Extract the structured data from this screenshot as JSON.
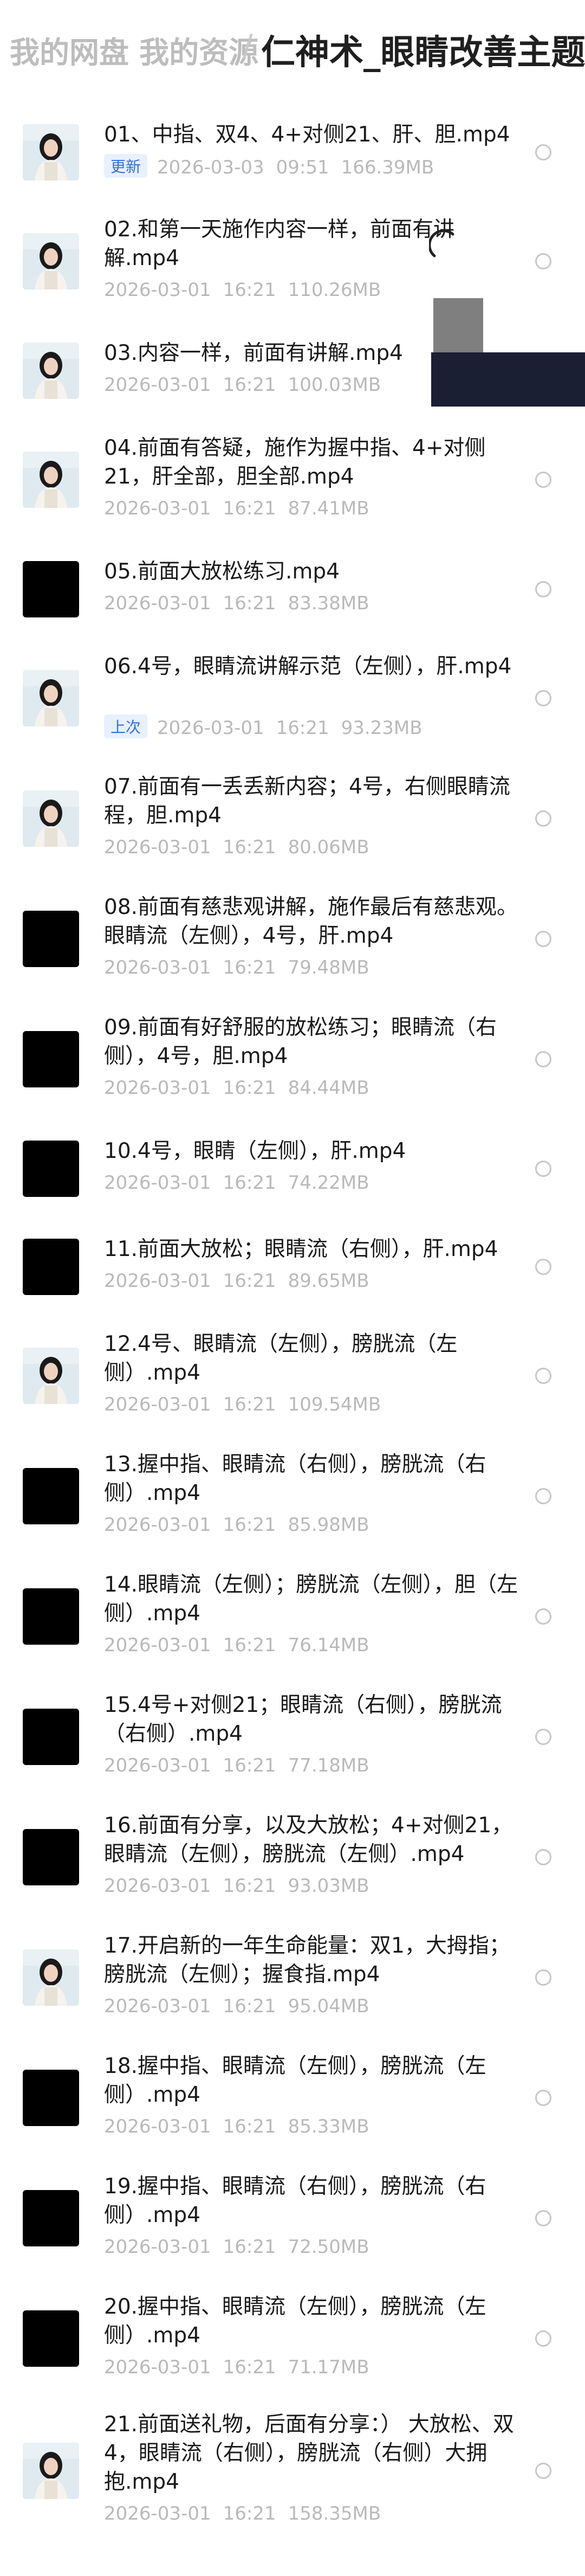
{
  "breadcrumb": {
    "root": "我的网盘 我的资源",
    "separator": "/",
    "current": "仁神术_眼睛改善主题共修"
  },
  "files": [
    {
      "name": "01、中指、双4、4+对侧21、肝、胆.mp4",
      "badge": "更新",
      "date": "2026-03-03",
      "time": "09:51",
      "size": "166.39MB",
      "thumb": "person"
    },
    {
      "name": "02.和第一天施作内容一样，前面有讲解.mp4",
      "badge": "",
      "date": "2026-03-01",
      "time": "16:21",
      "size": "110.26MB",
      "thumb": "person"
    },
    {
      "name": "03.内容一样，前面有讲解.mp4",
      "badge": "",
      "date": "2026-03-01",
      "time": "16:21",
      "size": "100.03MB",
      "thumb": "person"
    },
    {
      "name": "04.前面有答疑，施作为握中指、4+对侧21，肝全部，胆全部.mp4",
      "badge": "",
      "date": "2026-03-01",
      "time": "16:21",
      "size": "87.41MB",
      "thumb": "person"
    },
    {
      "name": "05.前面大放松练习.mp4",
      "badge": "",
      "date": "2026-03-01",
      "time": "16:21",
      "size": "83.38MB",
      "thumb": "black"
    },
    {
      "name": "06.4号，眼睛流讲解示范（左侧），肝.mp4",
      "badge": "上次",
      "date": "2026-03-01",
      "time": "16:21",
      "size": "93.23MB",
      "thumb": "person"
    },
    {
      "name": "07.前面有一丢丢新内容；4号，右侧眼睛流程，胆.mp4",
      "badge": "",
      "date": "2026-03-01",
      "time": "16:21",
      "size": "80.06MB",
      "thumb": "person"
    },
    {
      "name": "08.前面有慈悲观讲解，施作最后有慈悲观。眼睛流（左侧），4号，肝.mp4",
      "badge": "",
      "date": "2026-03-01",
      "time": "16:21",
      "size": "79.48MB",
      "thumb": "black"
    },
    {
      "name": "09.前面有好舒服的放松练习；眼睛流（右侧），4号，胆.mp4",
      "badge": "",
      "date": "2026-03-01",
      "time": "16:21",
      "size": "84.44MB",
      "thumb": "black"
    },
    {
      "name": "10.4号，眼睛（左侧），肝.mp4",
      "badge": "",
      "date": "2026-03-01",
      "time": "16:21",
      "size": "74.22MB",
      "thumb": "black"
    },
    {
      "name": "11.前面大放松；眼睛流（右侧），肝.mp4",
      "badge": "",
      "date": "2026-03-01",
      "time": "16:21",
      "size": "89.65MB",
      "thumb": "black"
    },
    {
      "name": "12.4号、眼睛流（左侧），膀胱流（左侧）.mp4",
      "badge": "",
      "date": "2026-03-01",
      "time": "16:21",
      "size": "109.54MB",
      "thumb": "person"
    },
    {
      "name": "13.握中指、眼睛流（右侧），膀胱流（右侧）.mp4",
      "badge": "",
      "date": "2026-03-01",
      "time": "16:21",
      "size": "85.98MB",
      "thumb": "black"
    },
    {
      "name": "14.眼睛流（左侧）；膀胱流（左侧），胆（左侧）.mp4",
      "badge": "",
      "date": "2026-03-01",
      "time": "16:21",
      "size": "76.14MB",
      "thumb": "black"
    },
    {
      "name": "15.4号+对侧21；眼睛流（右侧），膀胱流（右侧）.mp4",
      "badge": "",
      "date": "2026-03-01",
      "time": "16:21",
      "size": "77.18MB",
      "thumb": "black"
    },
    {
      "name": "16.前面有分享，以及大放松；4+对侧21，眼睛流（左侧），膀胱流（左侧）.mp4",
      "badge": "",
      "date": "2026-03-01",
      "time": "16:21",
      "size": "93.03MB",
      "thumb": "black"
    },
    {
      "name": "17.开启新的一年生命能量：双1，大拇指；膀胱流（左侧）；握食指.mp4",
      "badge": "",
      "date": "2026-03-01",
      "time": "16:21",
      "size": "95.04MB",
      "thumb": "person"
    },
    {
      "name": "18.握中指、眼睛流（左侧），膀胱流（左侧）.mp4",
      "badge": "",
      "date": "2026-03-01",
      "time": "16:21",
      "size": "85.33MB",
      "thumb": "black"
    },
    {
      "name": "19.握中指、眼睛流（右侧），膀胱流（右侧）.mp4",
      "badge": "",
      "date": "2026-03-01",
      "time": "16:21",
      "size": "72.50MB",
      "thumb": "black"
    },
    {
      "name": "20.握中指、眼睛流（左侧），膀胱流（左侧）.mp4",
      "badge": "",
      "date": "2026-03-01",
      "time": "16:21",
      "size": "71.17MB",
      "thumb": "black"
    },
    {
      "name": "21.前面送礼物，后面有分享：） 大放松、双4，眼睛流（右侧），膀胱流（右侧）大拥抱.mp4",
      "badge": "",
      "date": "2026-03-01",
      "time": "16:21",
      "size": "158.35MB",
      "thumb": "person"
    }
  ],
  "colors": {
    "badge_blue": "#2f6fe0",
    "meta_gray": "#b9b9b9",
    "title_dark": "#1f1f1f"
  }
}
